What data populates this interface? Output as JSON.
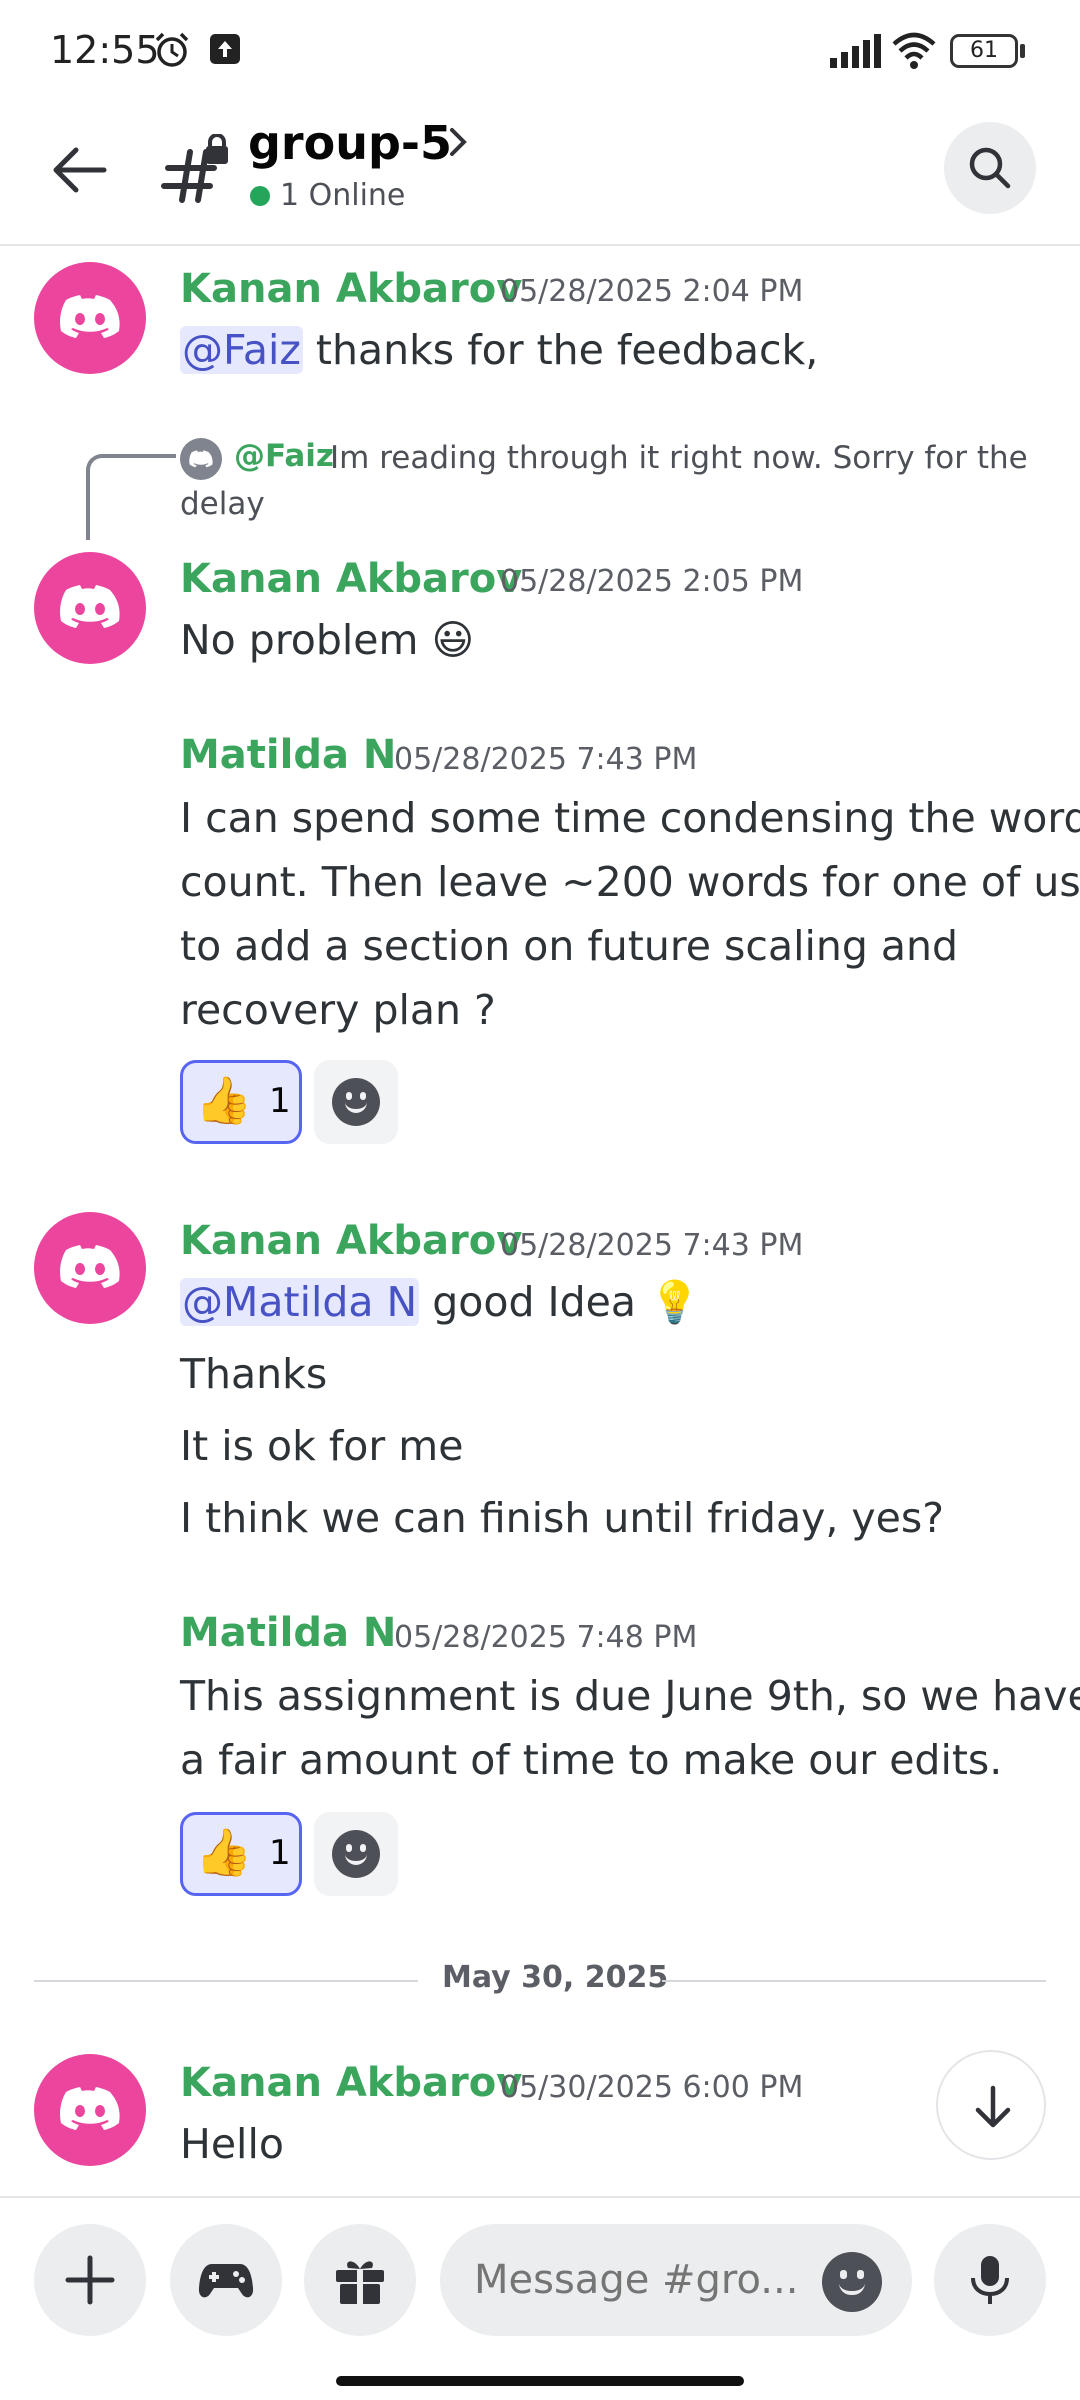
{
  "status_bar": {
    "time": "12:55",
    "battery": "61"
  },
  "header": {
    "channel_name": "group-5",
    "online_text": "1 Online"
  },
  "messages": [
    {
      "author": "Kanan Akbarov",
      "timestamp": "05/28/2025 2:04 PM",
      "lines": [
        {
          "mention": "@Faiz",
          "text": " thanks for the feedback,"
        }
      ]
    },
    {
      "reply": {
        "mention": "@Faiz",
        "text_line1": "Im reading through it right now. Sorry for the",
        "text_line2": "delay"
      },
      "author": "Kanan Akbarov",
      "timestamp": "05/28/2025 2:05 PM",
      "lines": [
        {
          "text": "No problem",
          "emoji": "😃"
        }
      ]
    },
    {
      "author": "Matilda N",
      "timestamp": "05/28/2025 7:43 PM",
      "lines": [
        {
          "text": "I can spend some time condensing the word"
        },
        {
          "text": "count. Then leave ~200 words for one of us"
        },
        {
          "text": "to add a section on future scaling and"
        },
        {
          "text": "recovery plan ?"
        }
      ],
      "reaction": {
        "emoji": "👍",
        "count": "1"
      }
    },
    {
      "author": "Kanan Akbarov",
      "timestamp": "05/28/2025 7:43 PM",
      "lines": [
        {
          "mention": "@Matilda N",
          "text": " good Idea",
          "emoji": "💡"
        },
        {
          "text": "Thanks"
        },
        {
          "text": "It is ok for me"
        },
        {
          "text": "I think we can finish until friday, yes?"
        }
      ]
    },
    {
      "author": "Matilda N",
      "timestamp": "05/28/2025 7:48 PM",
      "lines": [
        {
          "text": "This assignment is due June 9th, so we have"
        },
        {
          "text": "a fair amount of time to make our edits."
        }
      ],
      "reaction": {
        "emoji": "👍",
        "count": "1"
      }
    },
    {
      "author": "Kanan Akbarov",
      "timestamp": "05/30/2025 6:00 PM",
      "lines": [
        {
          "text": "Hello"
        }
      ]
    }
  ],
  "date_divider": "May 30, 2025",
  "composer": {
    "placeholder": "Message #gro..."
  },
  "icons": {
    "back": "arrow-left-icon",
    "channel": "locked-channel-hash-icon",
    "search": "search-icon",
    "add": "plus-icon",
    "games": "gamepad-icon",
    "gift": "gift-icon",
    "emoji": "smiley-icon",
    "mic": "microphone-icon",
    "jump": "arrow-down-icon"
  },
  "colors": {
    "author": "#3ba55d",
    "mention_bg": "#e6e8fd",
    "mention_text": "#4752c4",
    "avatar_bg": "#eb459e",
    "online": "#23a55a",
    "reaction_border": "#5865f2"
  }
}
